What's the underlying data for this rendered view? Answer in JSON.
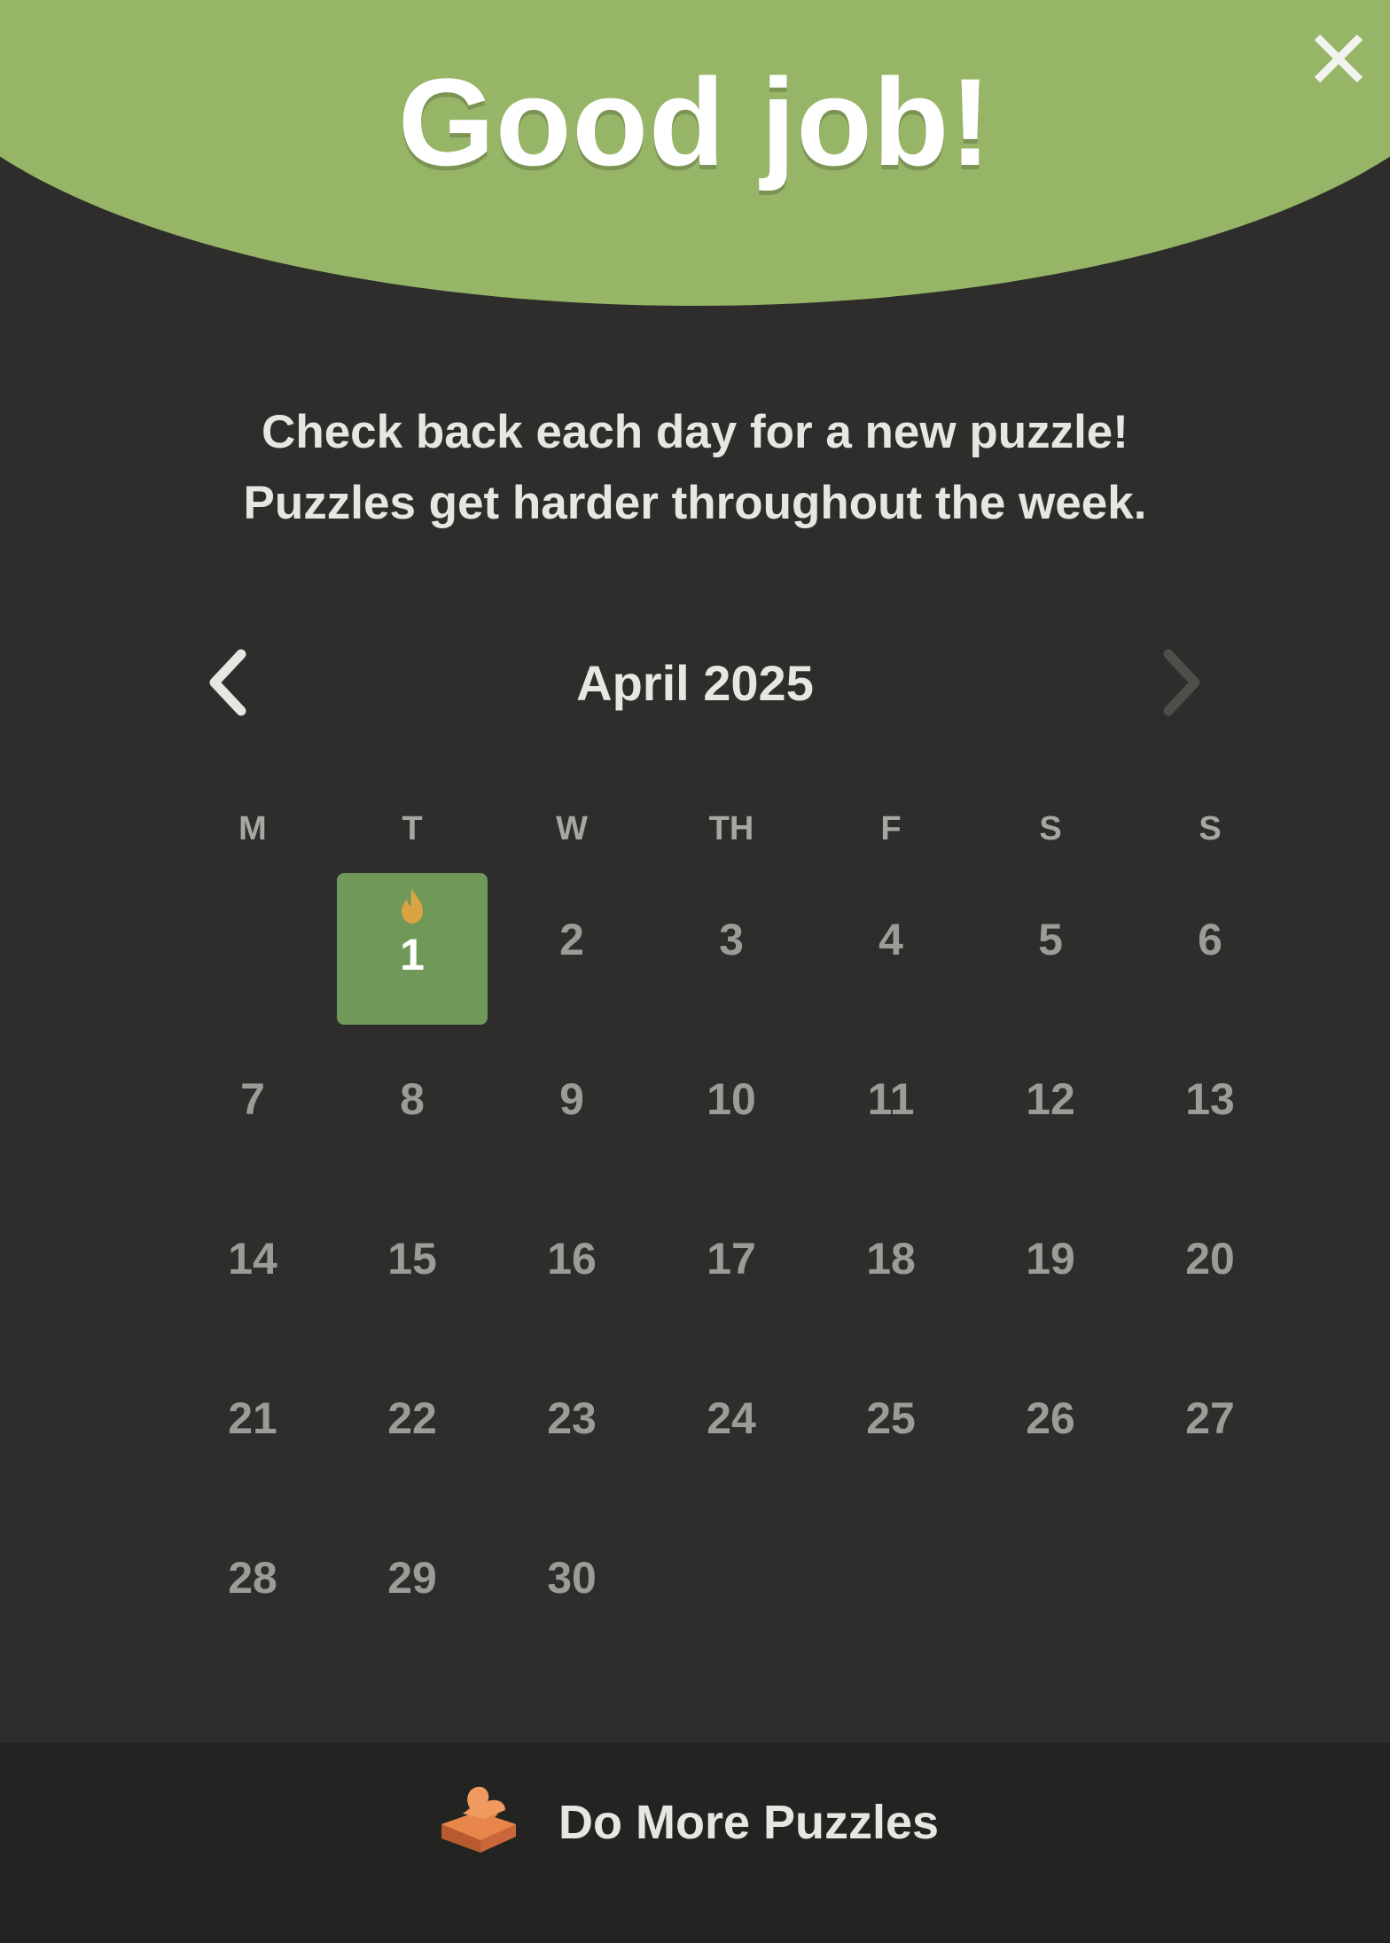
{
  "modal": {
    "title": "Good job!",
    "subtitle_line1": "Check back each day for a new puzzle!",
    "subtitle_line2": "Puzzles get harder throughout the week.",
    "close_icon": "close-icon"
  },
  "calendar": {
    "month_label": "April 2025",
    "prev_icon": "chevron-left-icon",
    "next_icon": "chevron-right-icon",
    "weekdays": [
      "M",
      "T",
      "W",
      "TH",
      "F",
      "S",
      "S"
    ],
    "weeks": [
      [
        "",
        "1",
        "2",
        "3",
        "4",
        "5",
        "6"
      ],
      [
        "7",
        "8",
        "9",
        "10",
        "11",
        "12",
        "13"
      ],
      [
        "14",
        "15",
        "16",
        "17",
        "18",
        "19",
        "20"
      ],
      [
        "21",
        "22",
        "23",
        "24",
        "25",
        "26",
        "27"
      ],
      [
        "28",
        "29",
        "30",
        "",
        "",
        "",
        ""
      ]
    ],
    "completed_day": "1",
    "completed_icon": "flame-icon"
  },
  "footer": {
    "more_button_label": "Do More Puzzles",
    "more_button_icon": "puzzle-piece-icon"
  },
  "colors": {
    "header_green": "#96b567",
    "completed_green": "#6f9859",
    "background": "#2e2d2b",
    "footer_background": "#232321",
    "flame": "#d9a441",
    "puzzle_orange": "#e8854a"
  }
}
